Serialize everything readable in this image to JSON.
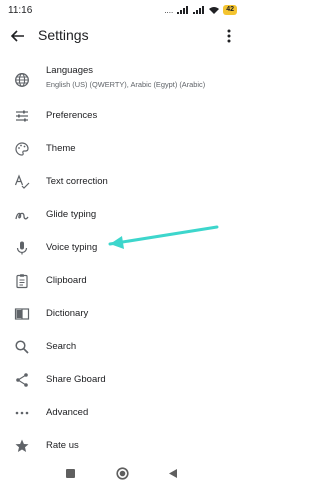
{
  "status_bar": {
    "time": "11:16",
    "signal_text": "....",
    "battery": "42"
  },
  "app_bar": {
    "title": "Settings"
  },
  "settings": {
    "items": [
      {
        "label": "Languages",
        "subtitle": "English (US) (QWERTY), Arabic (Egypt) (Arabic)",
        "icon": "globe-icon"
      },
      {
        "label": "Preferences",
        "icon": "sliders-icon"
      },
      {
        "label": "Theme",
        "icon": "palette-icon"
      },
      {
        "label": "Text correction",
        "icon": "text-correction-icon"
      },
      {
        "label": "Glide typing",
        "icon": "glide-icon"
      },
      {
        "label": "Voice typing",
        "icon": "mic-icon"
      },
      {
        "label": "Clipboard",
        "icon": "clipboard-icon"
      },
      {
        "label": "Dictionary",
        "icon": "dictionary-icon"
      },
      {
        "label": "Search",
        "icon": "search-icon"
      },
      {
        "label": "Share Gboard",
        "icon": "share-icon"
      },
      {
        "label": "Advanced",
        "icon": "more-horizontal-icon"
      },
      {
        "label": "Rate us",
        "icon": "star-icon"
      }
    ]
  },
  "annotation": {
    "arrow_color": "#3dd6cc",
    "points_to": "Voice typing"
  }
}
